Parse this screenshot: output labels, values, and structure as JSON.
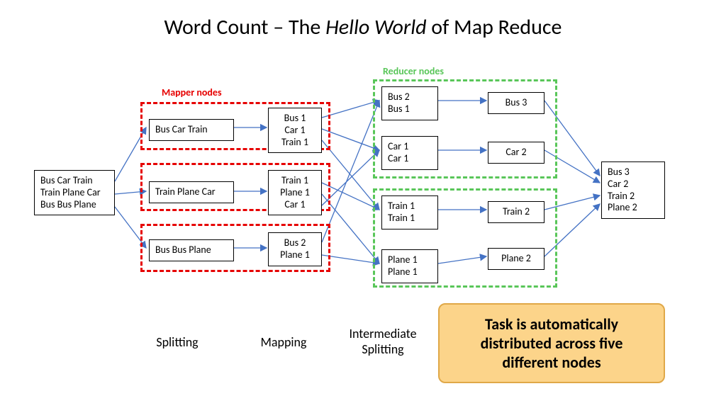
{
  "title_plain_1": "Word Count – The ",
  "title_italic": "Hello World",
  "title_plain_2": " of Map Reduce",
  "labels": {
    "mapper": "Mapper nodes",
    "reducer": "Reducer nodes"
  },
  "input": {
    "l1": "Bus Car Train",
    "l2": "Train Plane Car",
    "l3": "Bus Bus Plane"
  },
  "split": {
    "r1": "Bus Car Train",
    "r2": "Train Plane Car",
    "r3": "Bus Bus Plane"
  },
  "map": {
    "r1": {
      "a": "Bus 1",
      "b": "Car 1",
      "c": "Train 1"
    },
    "r2": {
      "a": "Train 1",
      "b": "Plane 1",
      "c": "Car 1"
    },
    "r3": {
      "a": "Bus 2",
      "b": "Plane 1"
    }
  },
  "shuffle": {
    "bus": {
      "a": "Bus 2",
      "b": "Bus 1"
    },
    "car": {
      "a": "Car 1",
      "b": "Car 1"
    },
    "train": {
      "a": "Train 1",
      "b": "Train 1"
    },
    "plane": {
      "a": "Plane 1",
      "b": "Plane 1"
    }
  },
  "reduce": {
    "bus": "Bus 3",
    "car": "Car 2",
    "train": "Train 2",
    "plane": "Plane 2"
  },
  "output": {
    "a": "Bus 3",
    "b": "Car 2",
    "c": "Train 2",
    "d": "Plane 2"
  },
  "phases": {
    "splitting": "Splitting",
    "mapping": "Mapping",
    "intermediate_splitting_l1": "Intermediate",
    "intermediate_splitting_l2": "Splitting"
  },
  "callout": {
    "l1": "Task is automatically",
    "l2": "distributed across five",
    "l3": "different nodes"
  },
  "colors": {
    "arrow": "#4472c4",
    "mapper_border": "#e60000",
    "reducer_border": "#59c659",
    "callout_bg": "#fcd48a",
    "callout_border": "#e0a848"
  }
}
